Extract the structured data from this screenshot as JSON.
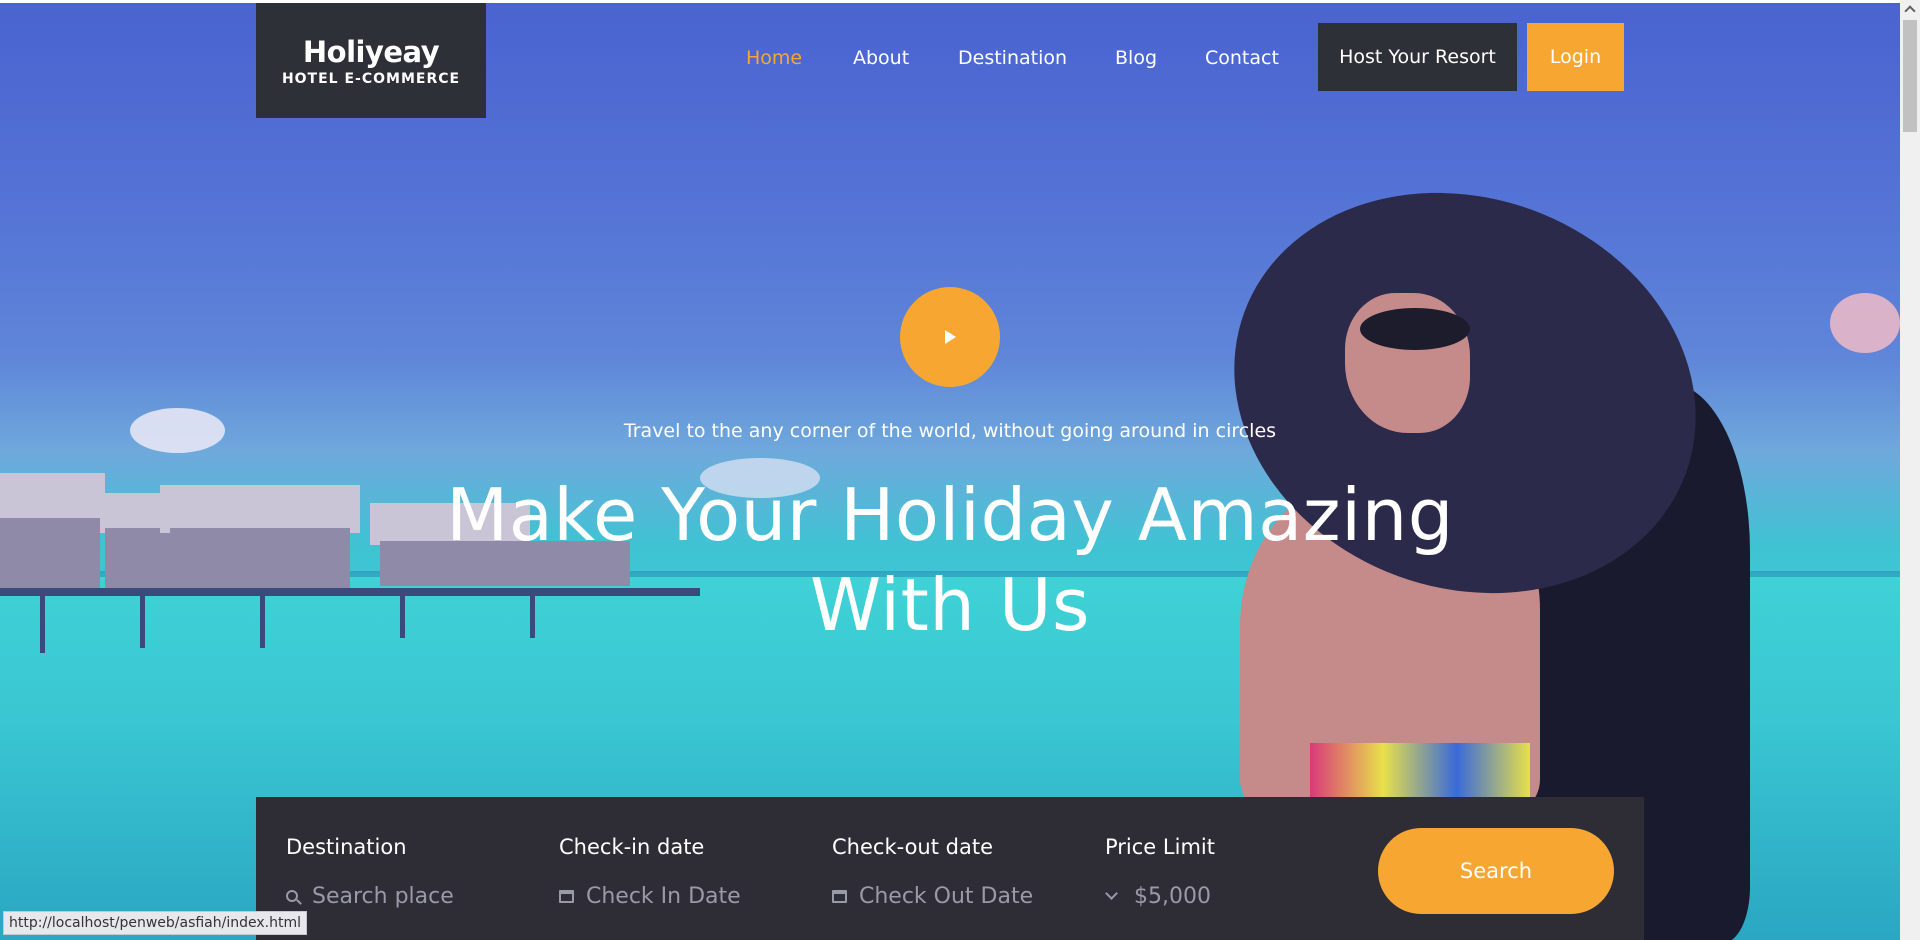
{
  "brand": {
    "title": "Holiyeay",
    "subtitle": "HOTEL E-COMMERCE"
  },
  "nav": {
    "items": [
      {
        "label": "Home",
        "active": true
      },
      {
        "label": "About",
        "active": false
      },
      {
        "label": "Destination",
        "active": false
      },
      {
        "label": "Blog",
        "active": false
      },
      {
        "label": "Contact",
        "active": false
      }
    ],
    "host_label": "Host Your Resort",
    "login_label": "Login"
  },
  "hero": {
    "tagline": "Travel to the any corner of the world, without going around in circles",
    "headline_line1": "Make Your Holiday Amazing",
    "headline_line2": "With Us",
    "play_icon": "play-icon"
  },
  "search": {
    "destination": {
      "label": "Destination",
      "placeholder": "Search place",
      "icon": "search-icon"
    },
    "checkin": {
      "label": "Check-in date",
      "placeholder": "Check In Date",
      "icon": "calendar-icon"
    },
    "checkout": {
      "label": "Check-out date",
      "placeholder": "Check Out Date",
      "icon": "calendar-icon"
    },
    "price": {
      "label": "Price Limit",
      "value": "$5,000",
      "icon": "chevron-down-icon"
    },
    "button_label": "Search"
  },
  "status": {
    "url": "http://localhost/penweb/asfiah/index.html"
  },
  "colors": {
    "accent": "#f7a731",
    "dark": "#2e3038",
    "search_bar": "#2e2d36"
  }
}
